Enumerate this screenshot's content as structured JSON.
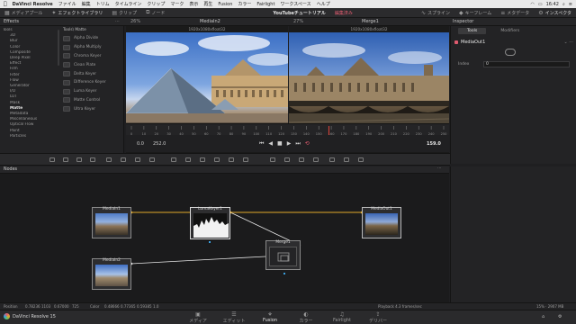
{
  "menubar": {
    "app_name": "DaVinci Resolve",
    "items": [
      "ファイル",
      "編集",
      "トリム",
      "タイムライン",
      "クリップ",
      "マーク",
      "表示",
      "再生",
      "Fusion",
      "カラー",
      "Fairlight",
      "ワークスペース",
      "ヘルプ"
    ],
    "time": "16:42"
  },
  "toolbar": {
    "media_pool": "メディアプール",
    "effects_library": "エフェクトライブラリ",
    "clips": "クリップ",
    "nodes": "ノード",
    "project_title": "YouTubeチュートリアル",
    "edited": "編集済み",
    "spline": "スプライン",
    "keyframes": "キーフレーム",
    "metadata": "メタデータ",
    "inspector": "インスペクタ"
  },
  "panels": {
    "effects_title": "Effects",
    "viewer_left_title": "MediaIn2",
    "viewer_left_zoom": "26%",
    "viewer_right_title": "Merge1",
    "viewer_right_zoom": "27%",
    "inspector_title": "Inspector",
    "nodes_title": "Nodes"
  },
  "effects": {
    "tree": [
      {
        "label": "Tools",
        "level": 0
      },
      {
        "label": "3D",
        "level": 1
      },
      {
        "label": "Blur",
        "level": 1
      },
      {
        "label": "Color",
        "level": 1
      },
      {
        "label": "Composite",
        "level": 1
      },
      {
        "label": "Deep Pixel",
        "level": 1
      },
      {
        "label": "Effect",
        "level": 1
      },
      {
        "label": "Film",
        "level": 1
      },
      {
        "label": "Filter",
        "level": 1
      },
      {
        "label": "Flow",
        "level": 1
      },
      {
        "label": "Generator",
        "level": 1
      },
      {
        "label": "I/O",
        "level": 1
      },
      {
        "label": "LUT",
        "level": 1
      },
      {
        "label": "Mask",
        "level": 1
      },
      {
        "label": "Matte",
        "level": 1,
        "selected": true
      },
      {
        "label": "Metadata",
        "level": 1
      },
      {
        "label": "Miscellaneous",
        "level": 1
      },
      {
        "label": "Optical Flow",
        "level": 1
      },
      {
        "label": "Paint",
        "level": 1
      },
      {
        "label": "Particles",
        "level": 1
      }
    ],
    "tools_heading": "Tools\\ Matte",
    "tools": [
      "Alpha Divide",
      "Alpha Multiply",
      "Chroma Keyer",
      "Clean Plate",
      "Delta Keyer",
      "Difference Keyer",
      "Luma Keyer",
      "Matte Control",
      "Ultra Keyer"
    ]
  },
  "viewer": {
    "resolution_left": "1920x1080xfloat32",
    "resolution_right": "1920x1080xfloat32",
    "ruler_ticks": [
      "0",
      "10",
      "20",
      "30",
      "40",
      "50",
      "60",
      "70",
      "80",
      "90",
      "100",
      "110",
      "120",
      "130",
      "140",
      "150",
      "160",
      "170",
      "180",
      "190",
      "200",
      "210",
      "220",
      "230",
      "240",
      "250"
    ],
    "start_tc": "0.0",
    "end_tc": "252.0",
    "current_tc": "159.0",
    "playhead_fraction": 0.631
  },
  "inspector": {
    "tab_tools": "Tools",
    "tab_modifiers": "Modifiers",
    "node_name": "MediaOut1",
    "field_label": "Index",
    "field_value": "0"
  },
  "nodes": {
    "items": [
      {
        "id": "MediaIn1",
        "label": "MediaIn1"
      },
      {
        "id": "LumaKeyer1",
        "label": "LumaKeyer1"
      },
      {
        "id": "MediaOut1",
        "label": "MediaOut1"
      },
      {
        "id": "Merge1",
        "label": "Merge1"
      },
      {
        "id": "MediaIn2",
        "label": "MediaIn2"
      }
    ]
  },
  "status": {
    "position_label": "Position",
    "pos_x": "0.78236",
    "pos_y": "1103",
    "pos_val": "0.67000",
    "pos_z": "725",
    "color_label": "Color",
    "r": "0.48666",
    "g": "0.77365",
    "b": "0.59385",
    "a": "1.0",
    "playback": "Playback 4.3 frames/sec",
    "memory": "15% · 2907 MB"
  },
  "pages": {
    "app_label": "DaVinci Resolve 15",
    "items": [
      {
        "label": "メディア",
        "icon": "media-icon"
      },
      {
        "label": "エディット",
        "icon": "edit-icon"
      },
      {
        "label": "Fusion",
        "icon": "fusion-icon",
        "active": true
      },
      {
        "label": "カラー",
        "icon": "color-icon"
      },
      {
        "label": "Fairlight",
        "icon": "fairlight-icon"
      },
      {
        "label": "デリバー",
        "icon": "deliver-icon"
      }
    ]
  },
  "colors": {
    "accent": "#e05b6f",
    "link": "#e0a92a",
    "background": "#1f1f21"
  }
}
